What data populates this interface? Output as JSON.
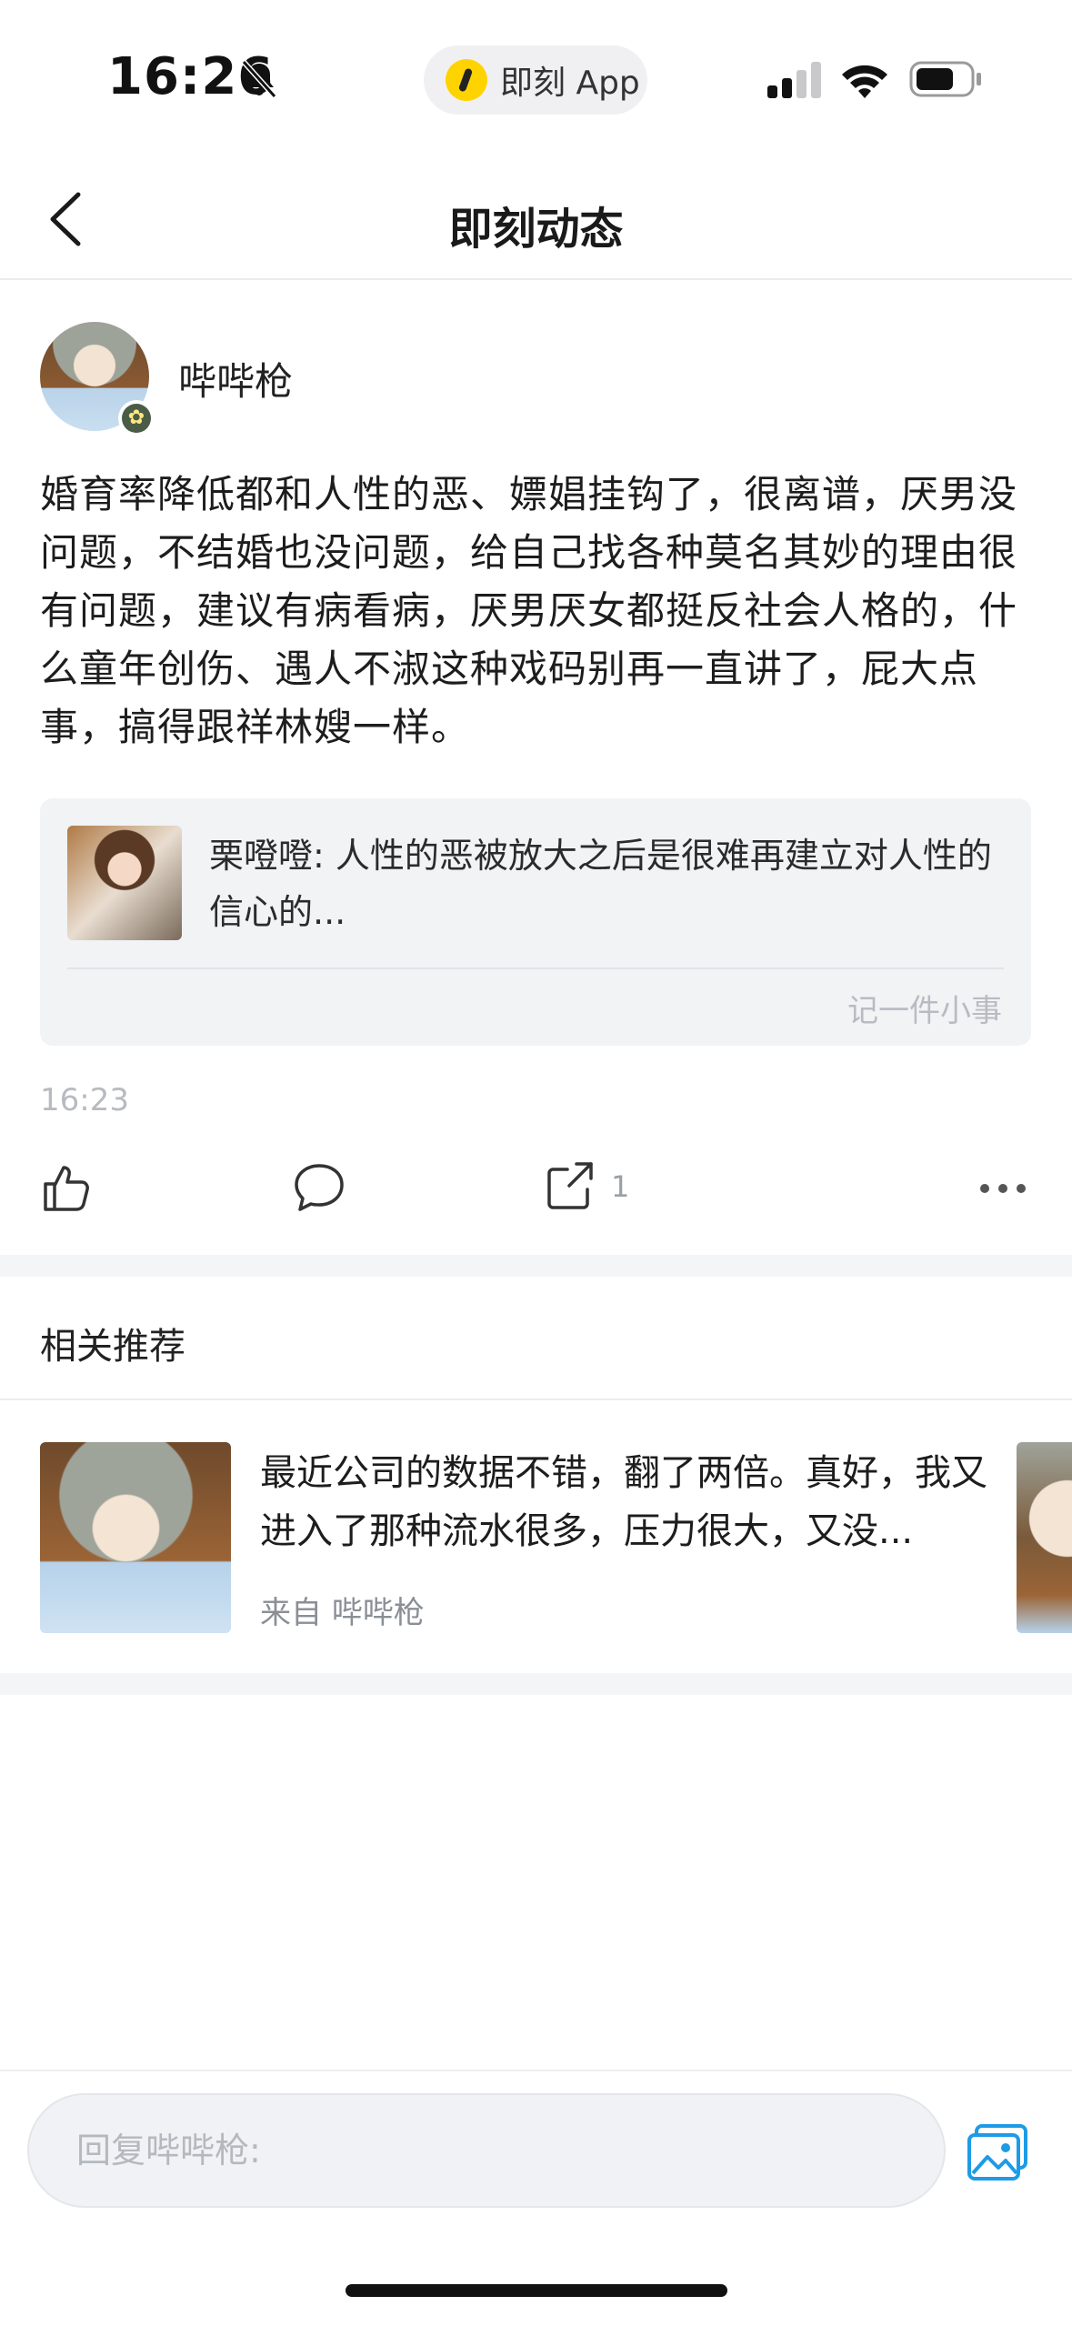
{
  "status_bar": {
    "time": "16:26",
    "app_name": "即刻 App"
  },
  "header": {
    "title": "即刻动态"
  },
  "post": {
    "username": "哔哔枪",
    "content": "婚育率降低都和人性的恶、嫖娼挂钩了，很离谱，厌男没问题，不结婚也没问题，给自己找各种莫名其妙的理由很有问题，建议有病看病，厌男厌女都挺反社会人格的，什么童年创伤、遇人不淑这种戏码别再一直讲了，屁大点事，搞得跟祥林嫂一样。",
    "quote": {
      "text": "栗噔噔: 人性的恶被放大之后是很难再建立对人性的信心的...",
      "footer": "记一件小事"
    },
    "time": "16:23",
    "share_count": "1"
  },
  "related": {
    "title": "相关推荐",
    "items": [
      {
        "text": "最近公司的数据不错，翻了两倍。真好，我又进入了那种流水很多，压力很大，又没...",
        "source": "来自 哔哔枪"
      }
    ]
  },
  "reply": {
    "placeholder": "回复哔哔枪:"
  },
  "colors": {
    "accent_blue": "#1e9be6",
    "app_logo_yellow": "#ffd300",
    "muted_text": "#b7bbc0"
  },
  "icons": [
    "bell-slash-icon",
    "signal-icon",
    "wifi-icon",
    "battery-icon",
    "back-icon",
    "like-icon",
    "comment-icon",
    "share-icon",
    "more-icon",
    "image-icon"
  ]
}
